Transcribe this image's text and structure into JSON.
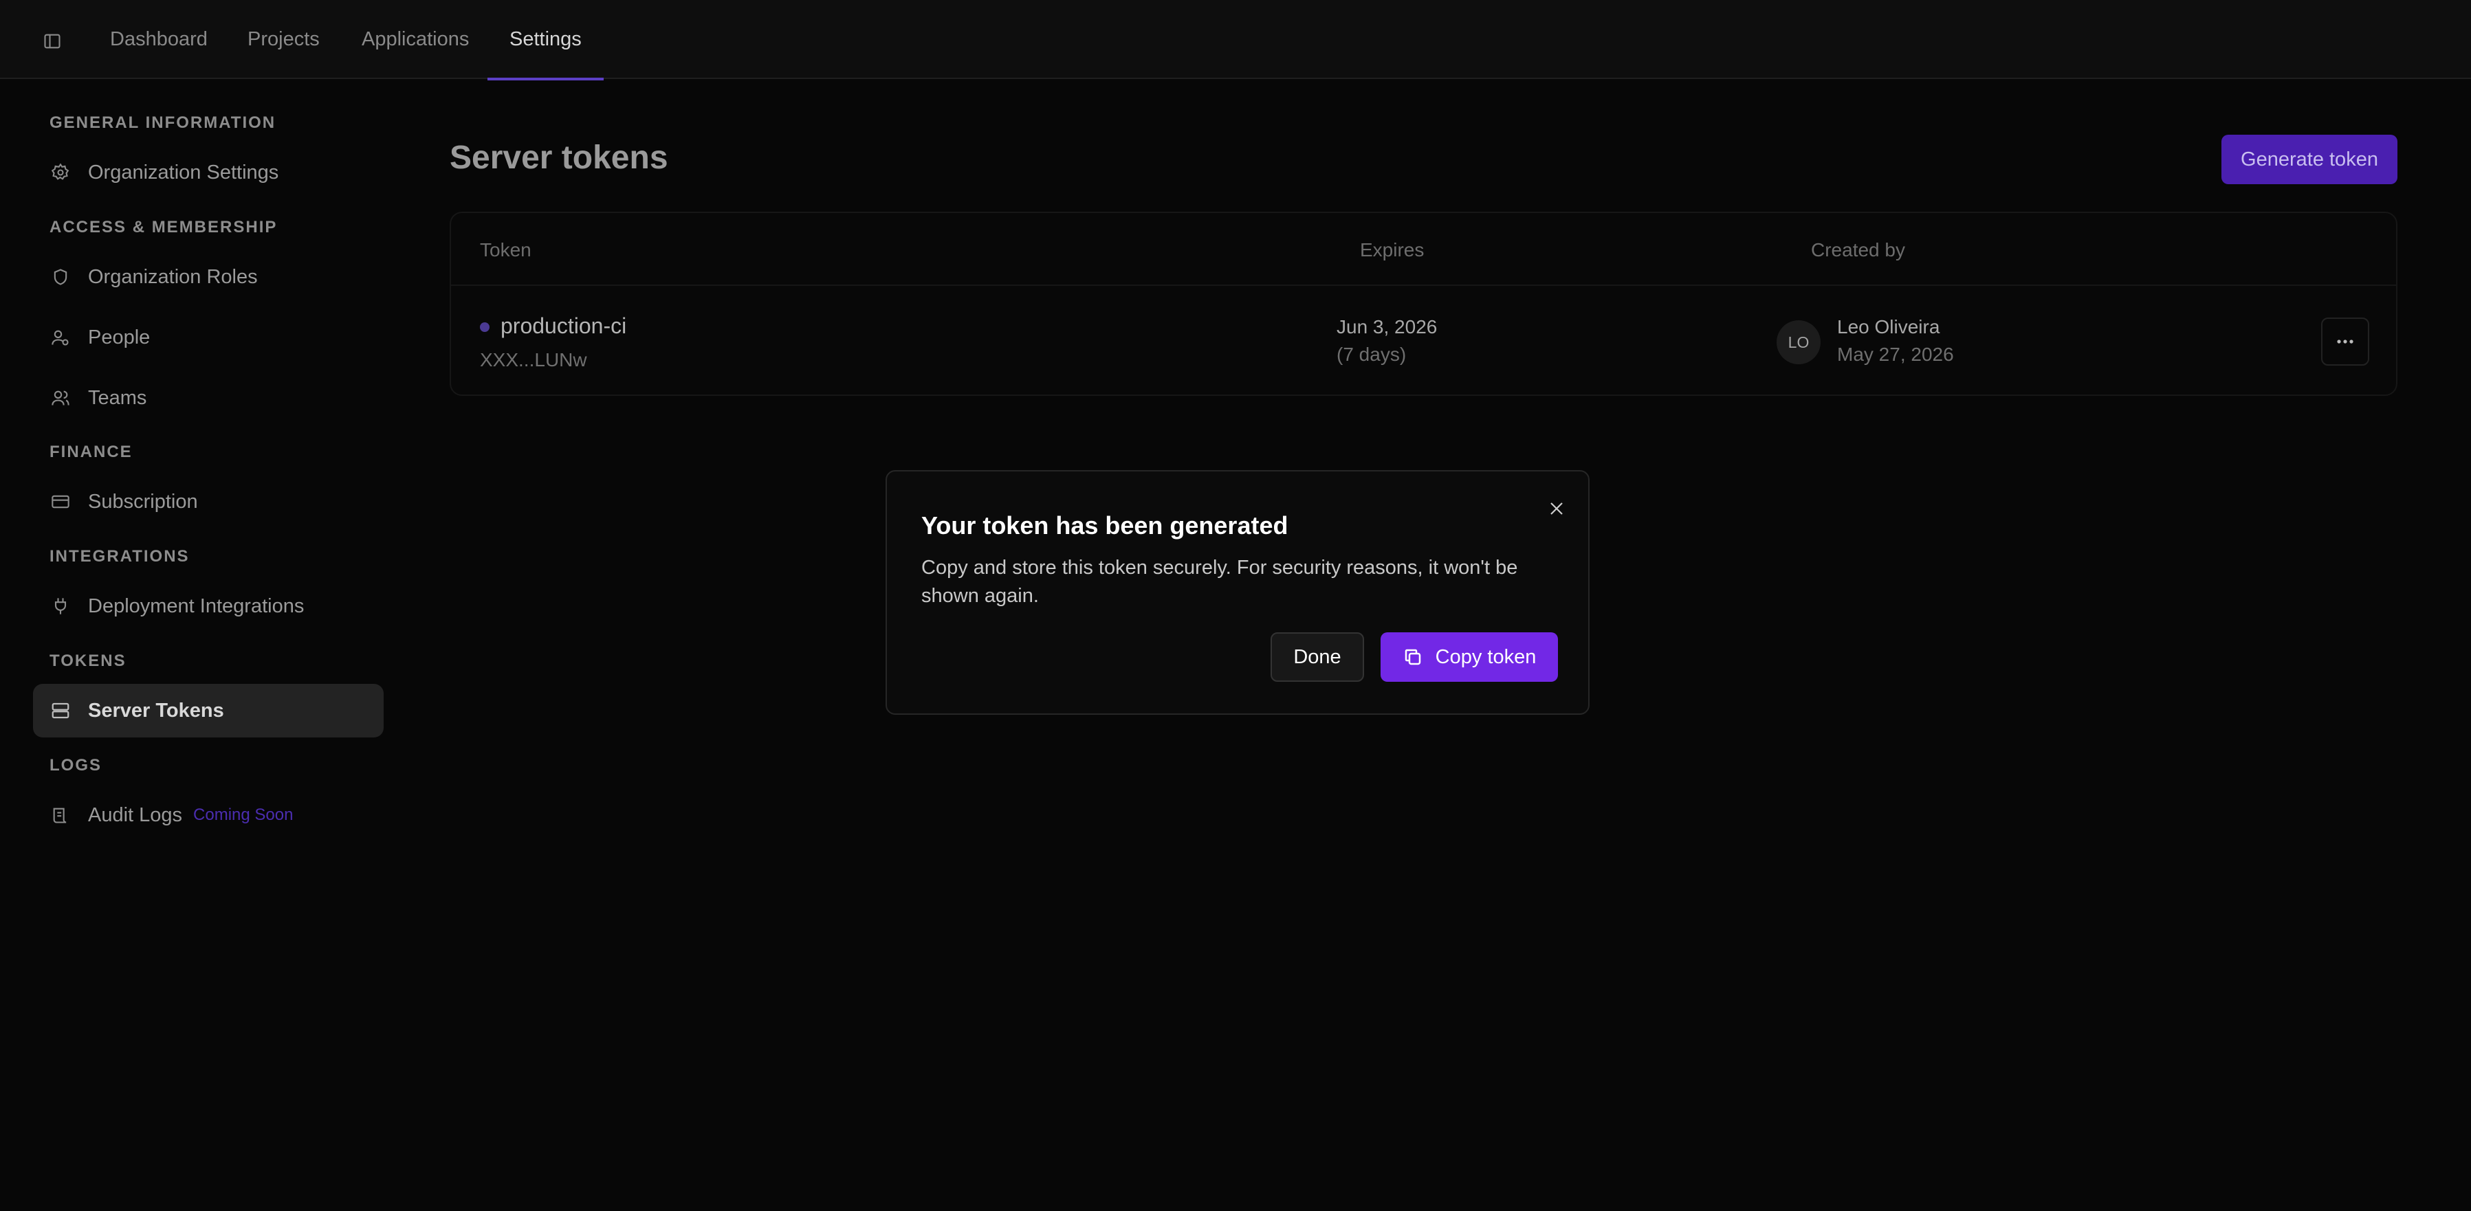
{
  "topbar": {
    "tabs": [
      {
        "label": "Dashboard"
      },
      {
        "label": "Projects"
      },
      {
        "label": "Applications"
      },
      {
        "label": "Settings",
        "active": true
      }
    ],
    "accent_color": "#5b3fc4"
  },
  "sidebar": {
    "sections": [
      {
        "title": "GENERAL INFORMATION",
        "items": [
          {
            "label": "Organization Settings",
            "icon": "gear-icon"
          }
        ]
      },
      {
        "title": "ACCESS & MEMBERSHIP",
        "items": [
          {
            "label": "Organization Roles",
            "icon": "shield-icon"
          },
          {
            "label": "People",
            "icon": "user-icon"
          },
          {
            "label": "Teams",
            "icon": "users-icon"
          }
        ]
      },
      {
        "title": "FINANCE",
        "items": [
          {
            "label": "Subscription",
            "icon": "credit-card-icon"
          }
        ]
      },
      {
        "title": "INTEGRATIONS",
        "items": [
          {
            "label": "Deployment Integrations",
            "icon": "plug-icon"
          }
        ]
      },
      {
        "title": "TOKENS",
        "items": [
          {
            "label": "Server Tokens",
            "icon": "server-icon",
            "active": true
          }
        ]
      },
      {
        "title": "LOGS",
        "items": [
          {
            "label": "Audit Logs",
            "icon": "scroll-icon",
            "badge": "Coming Soon"
          }
        ]
      }
    ]
  },
  "main": {
    "title": "Server tokens",
    "generate_button": "Generate token",
    "table": {
      "columns": [
        "Token",
        "Expires",
        "Created by"
      ],
      "rows": [
        {
          "name": "production-ci",
          "masked": "XXX...LUNw",
          "expires": "Jun 3, 2026",
          "expires_relative": "(7 days)",
          "creator_initials": "LO",
          "creator_name": "Leo Oliveira",
          "created_date": "May 27, 2026"
        }
      ]
    }
  },
  "modal": {
    "title": "Your token has been generated",
    "description": "Copy and store this token securely. For security reasons, it won't be shown again.",
    "done_label": "Done",
    "copy_label": "Copy token",
    "primary_color": "#7228e6"
  }
}
